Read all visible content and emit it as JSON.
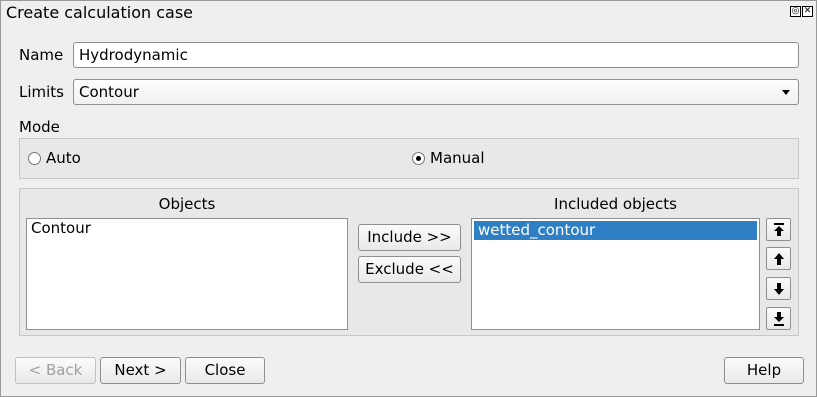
{
  "window": {
    "title": "Create calculation case"
  },
  "form": {
    "name_label": "Name",
    "name_value": "Hydrodynamic",
    "limits_label": "Limits",
    "limits_value": "Contour",
    "mode_label": "Mode",
    "mode_options": [
      {
        "label": "Auto",
        "checked": false
      },
      {
        "label": "Manual",
        "checked": true
      }
    ]
  },
  "objects_panel": {
    "objects_header": "Objects",
    "objects": [
      "Contour"
    ],
    "included_header": "Included objects",
    "included": [
      "wetted_contour"
    ],
    "include_label": "Include >>",
    "exclude_label": "Exclude <<",
    "order_icons": [
      "move-top-icon",
      "move-up-icon",
      "move-down-icon",
      "move-bottom-icon"
    ]
  },
  "footer": {
    "back_label": "< Back",
    "next_label": "Next >",
    "close_label": "Close",
    "help_label": "Help"
  },
  "colors": {
    "selection": "#2f7fc4"
  }
}
